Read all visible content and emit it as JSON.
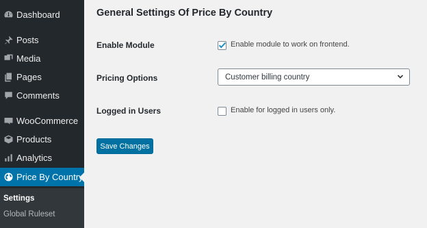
{
  "sidebar": {
    "items": [
      {
        "label": "Dashboard",
        "icon": "dashboard-icon"
      },
      {
        "label": "Posts",
        "icon": "pin-icon"
      },
      {
        "label": "Media",
        "icon": "media-icon"
      },
      {
        "label": "Pages",
        "icon": "pages-icon"
      },
      {
        "label": "Comments",
        "icon": "comment-icon"
      },
      {
        "label": "WooCommerce",
        "icon": "woocommerce-icon"
      },
      {
        "label": "Products",
        "icon": "box-icon"
      },
      {
        "label": "Analytics",
        "icon": "bar-chart-icon"
      },
      {
        "label": "Price By Country",
        "icon": "globe-icon",
        "active": true
      }
    ],
    "submenu": [
      {
        "label": "Settings",
        "current": true
      },
      {
        "label": "Global Ruleset"
      }
    ]
  },
  "main": {
    "title": "General Settings Of Price By Country",
    "enable_module": {
      "label": "Enable Module",
      "checkbox_label": "Enable module to work on frontend.",
      "checked": true
    },
    "pricing_options": {
      "label": "Pricing Options",
      "selected": "Customer billing country"
    },
    "logged_in_users": {
      "label": "Logged in Users",
      "checkbox_label": "Enable for logged in users only.",
      "checked": false
    },
    "save_label": "Save Changes"
  },
  "colors": {
    "sidebar_bg": "#23282d",
    "active_bg": "#0073aa",
    "button_bg": "#0071a1",
    "page_bg": "#f1f1f1"
  }
}
